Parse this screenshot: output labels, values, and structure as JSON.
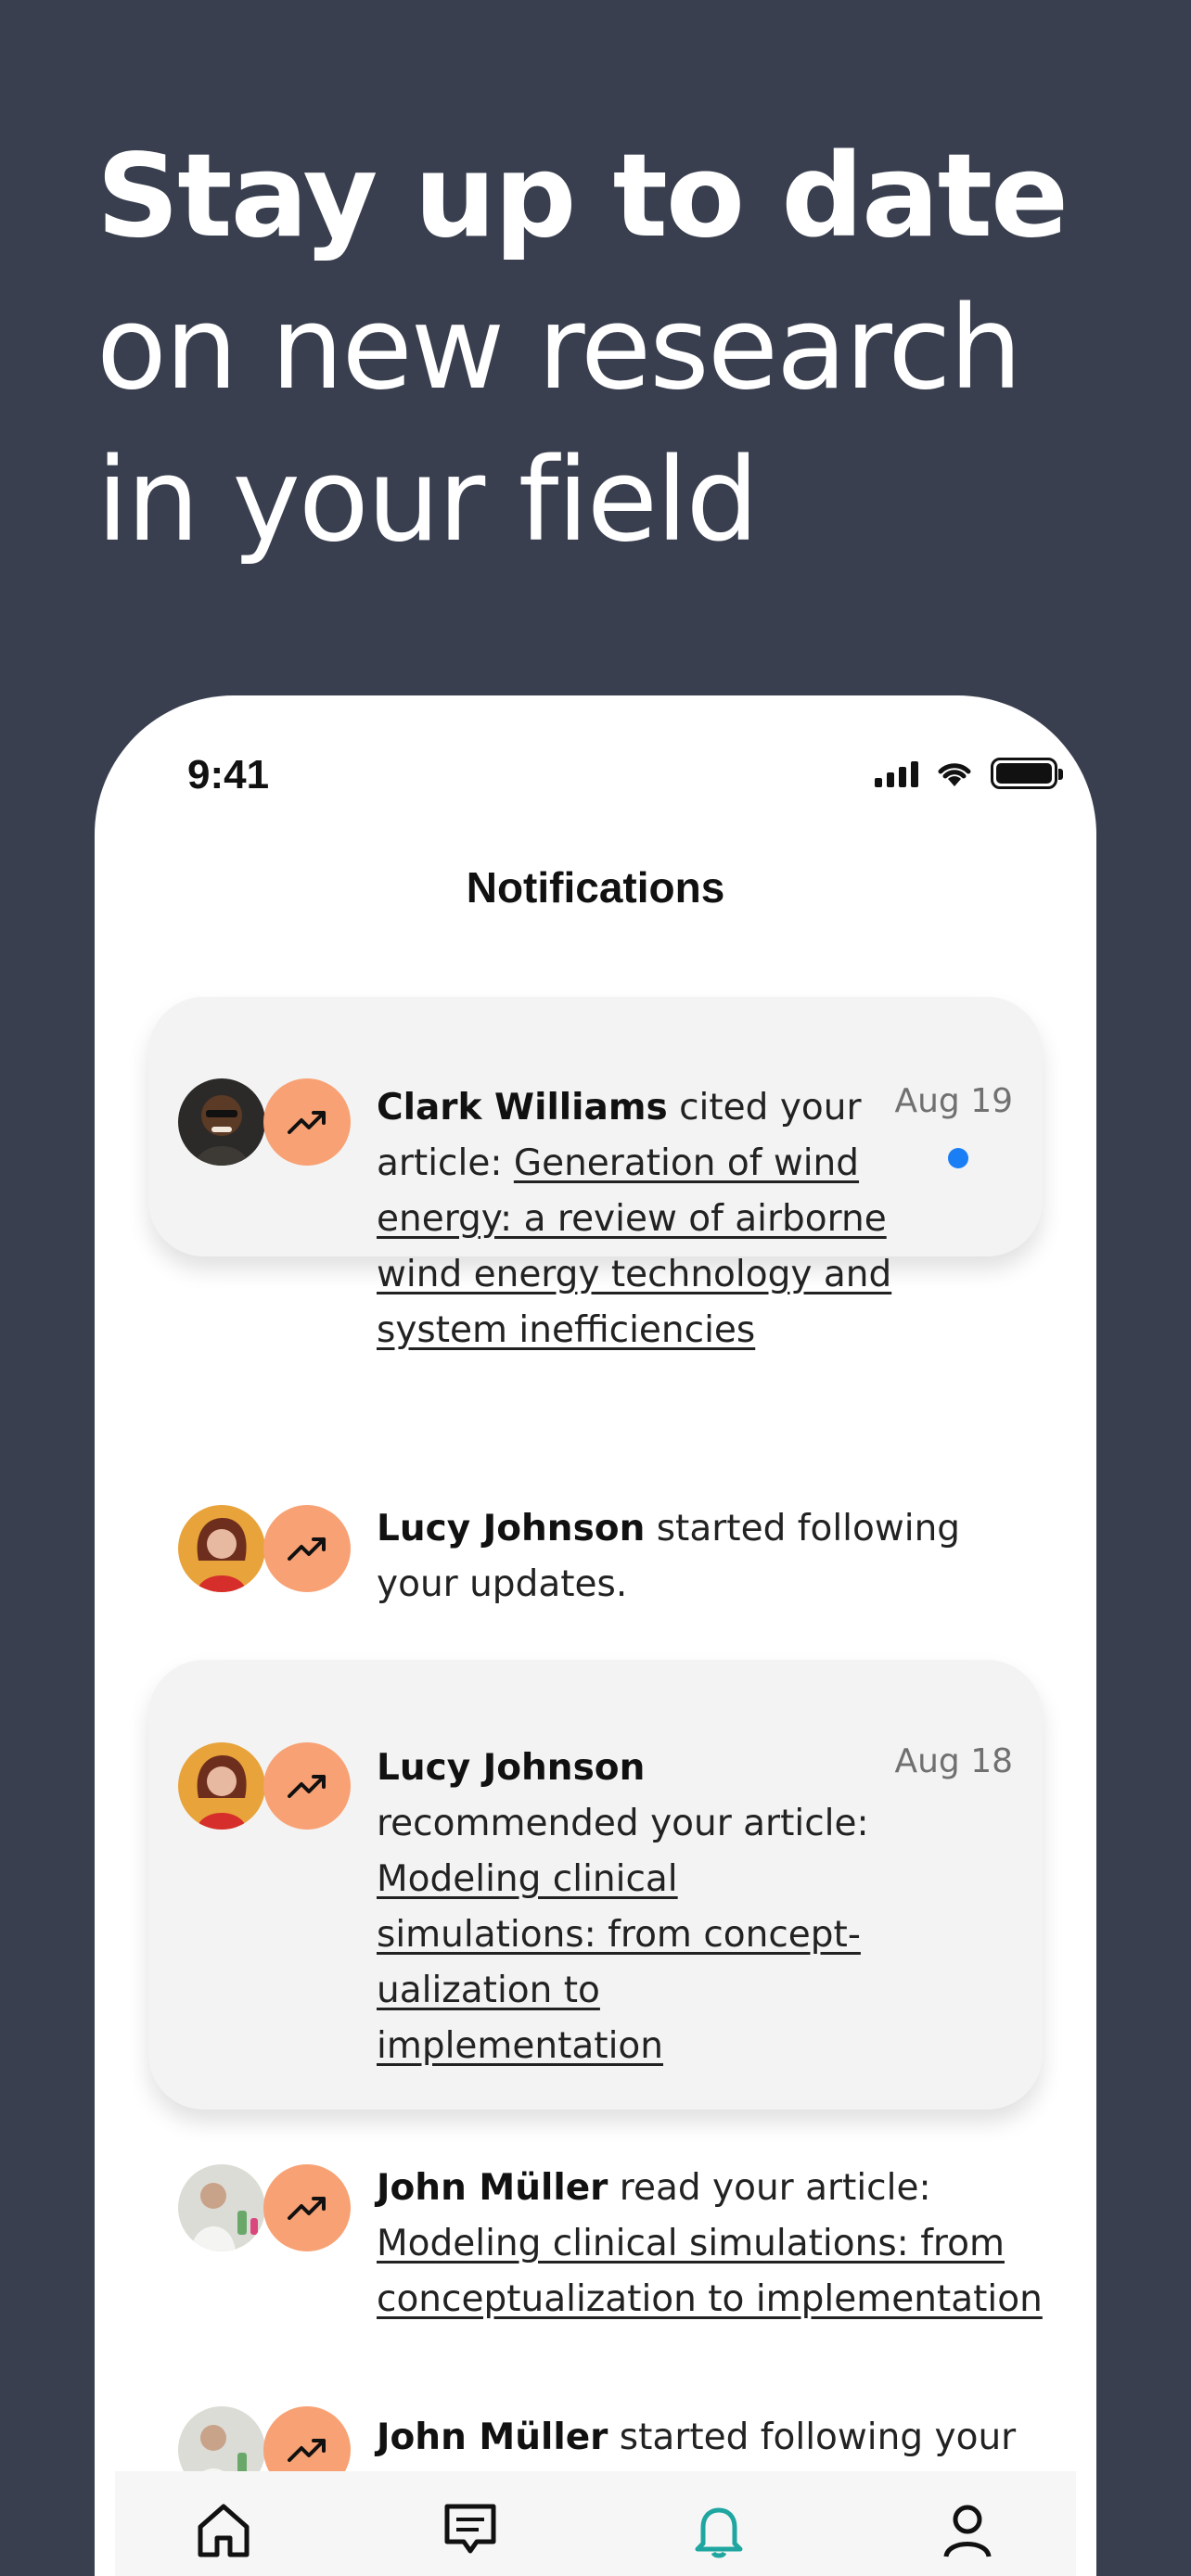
{
  "headline": {
    "line1": "Stay up to date",
    "line2": "on new research",
    "line3": "in your field"
  },
  "phone": {
    "status_time": "9:41",
    "title": "Notifications"
  },
  "notifications": [
    {
      "name": "Clark Williams",
      "action": " cited your article: ",
      "link": "Generation of wind energy: a review of airborne wind energy technology and system inefficiencies",
      "date": "Aug 19",
      "unread": true
    },
    {
      "name": "Lucy Johnson",
      "action": " started following your updates.",
      "link": "",
      "date": ""
    },
    {
      "name": "Lucy Johnson",
      "action": " recommended your article: ",
      "link": "Modeling clinical simulations: from concept-ualization to implementation",
      "date": "Aug 18"
    },
    {
      "name": "John Müller",
      "action": " read your article: ",
      "link": "Modeling clinical simulations: from conceptualization to implementation",
      "date": ""
    },
    {
      "name": "John Müller",
      "action": " started following your",
      "link": "",
      "date": ""
    }
  ],
  "icons": {
    "trend": "trending-up-icon",
    "tabs": [
      "home-icon",
      "messages-icon",
      "notifications-bell-icon",
      "profile-icon"
    ]
  },
  "colors": {
    "background": "#393f4f",
    "trend_badge": "#f8a174",
    "unread_dot": "#1a7ef5",
    "active_tab": "#1fa6a0",
    "card": "#f3f3f3"
  }
}
